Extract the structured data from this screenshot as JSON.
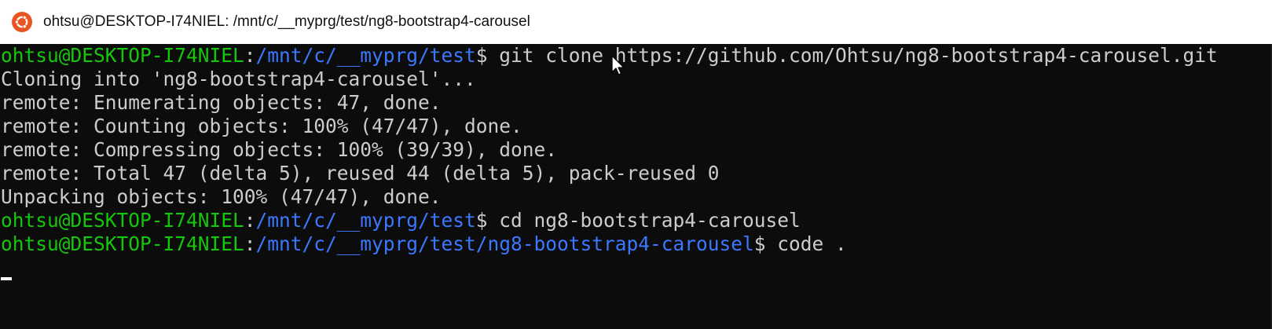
{
  "window": {
    "title": "ohtsu@DESKTOP-I74NIEL: /mnt/c/__myprg/test/ng8-bootstrap4-carousel",
    "icon": "ubuntu-icon",
    "accent_color": "#e95420"
  },
  "terminal": {
    "colors": {
      "user": "#16c60c",
      "path": "#3b78ff",
      "text": "#cccccc",
      "background": "#0c0c0c"
    },
    "prompts": [
      {
        "user_host": "ohtsu@DESKTOP-I74NIEL",
        "colon": ":",
        "path": "/mnt/c/__myprg/test",
        "command": "$ git clone https://github.com/Ohtsu/ng8-bootstrap4-carousel.git"
      },
      {
        "user_host": "ohtsu@DESKTOP-I74NIEL",
        "colon": ":",
        "path": "/mnt/c/__myprg/test",
        "command": "$ cd ng8-bootstrap4-carousel"
      },
      {
        "user_host": "ohtsu@DESKTOP-I74NIEL",
        "colon": ":",
        "path": "/mnt/c/__myprg/test/ng8-bootstrap4-carousel",
        "command": "$ code ."
      }
    ],
    "output_lines": [
      "Cloning into 'ng8-bootstrap4-carousel'...",
      "remote: Enumerating objects: 47, done.",
      "remote: Counting objects: 100% (47/47), done.",
      "remote: Compressing objects: 100% (39/39), done.",
      "remote: Total 47 (delta 5), reused 44 (delta 5), pack-reused 0",
      "Unpacking objects: 100% (47/47), done."
    ]
  }
}
